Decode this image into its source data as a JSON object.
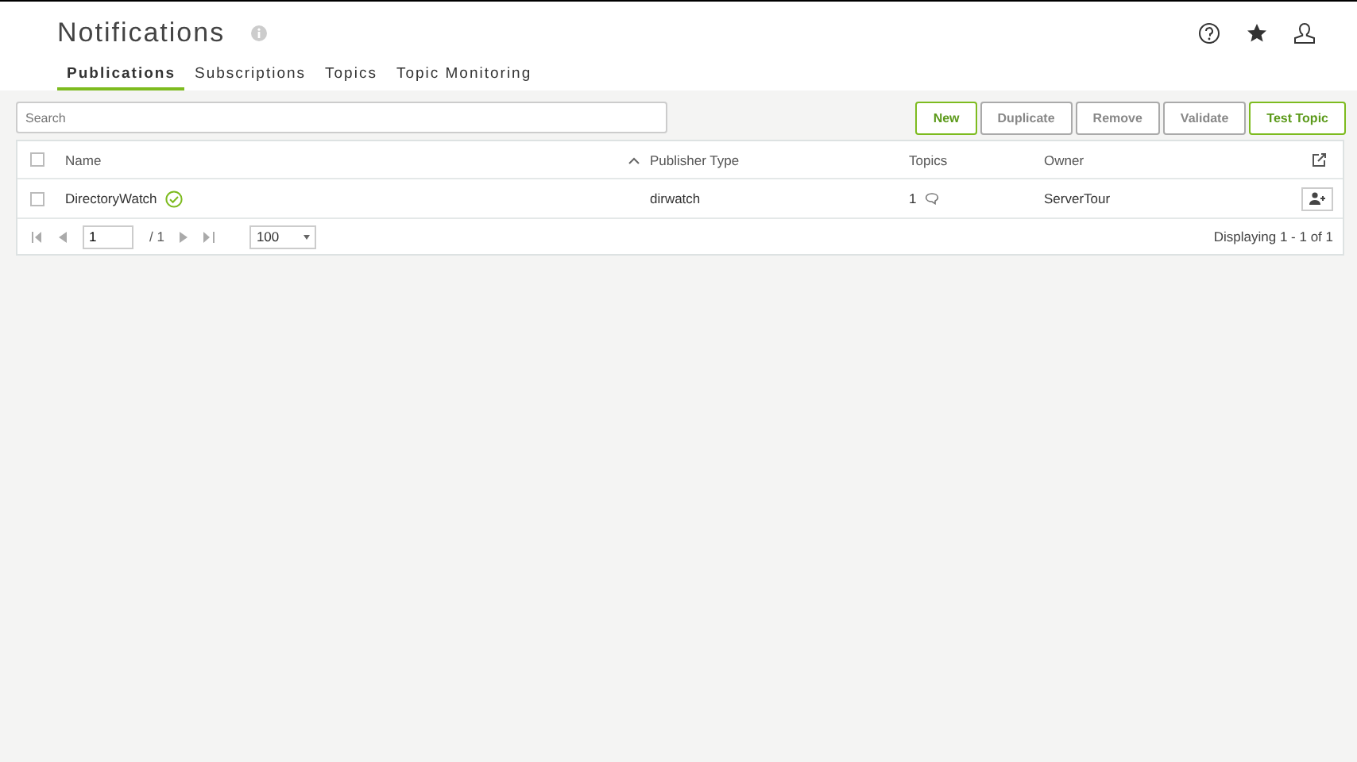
{
  "header": {
    "title": "Notifications"
  },
  "tabs": [
    {
      "label": "Publications",
      "selected": true
    },
    {
      "label": "Subscriptions",
      "selected": false
    },
    {
      "label": "Topics",
      "selected": false
    },
    {
      "label": "Topic Monitoring",
      "selected": false
    }
  ],
  "search": {
    "placeholder": "Search"
  },
  "buttons": [
    {
      "label": "New",
      "disabled": false
    },
    {
      "label": "Duplicate",
      "disabled": true
    },
    {
      "label": "Remove",
      "disabled": true
    },
    {
      "label": "Validate",
      "disabled": true
    },
    {
      "label": "Test Topic",
      "disabled": false
    }
  ],
  "table": {
    "select_all_checked": false,
    "columns": [
      "Name",
      "Publisher Type",
      "Topics",
      "Owner"
    ],
    "rows": [
      {
        "name": "DirectoryWatch",
        "valid": true,
        "checked": false,
        "publisher_type": "dirwatch",
        "topics": "1",
        "owner": "ServerTour"
      }
    ]
  },
  "pager": {
    "page": "1",
    "total": "/ 1",
    "page_size": "100",
    "status": "Displaying 1 - 1 of 1"
  }
}
